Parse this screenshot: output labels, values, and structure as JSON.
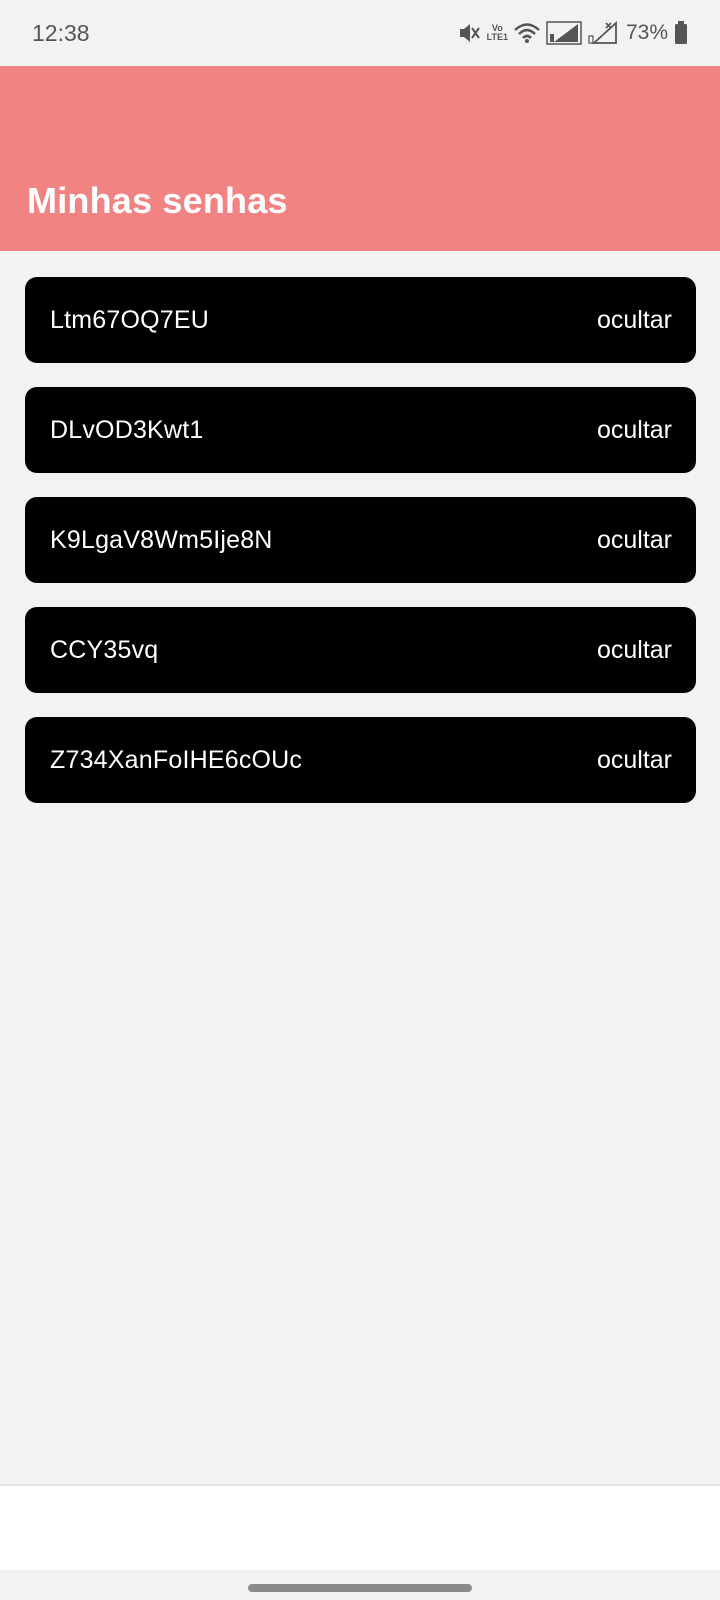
{
  "status_bar": {
    "time": "12:38",
    "battery_percent": "73%",
    "icons": [
      "mute-icon",
      "volte-icon",
      "wifi-icon",
      "signal-icon",
      "no-signal-icon",
      "battery-icon"
    ],
    "volte_label_top": "Vo",
    "volte_label_bottom": "LTE1"
  },
  "header": {
    "title": "Minhas senhas",
    "color": "#f28383"
  },
  "passwords": [
    {
      "value": "Ltm67OQ7EU",
      "toggle_label": "ocultar"
    },
    {
      "value": "DLvOD3Kwt1",
      "toggle_label": "ocultar"
    },
    {
      "value": "K9LgaV8Wm5Ije8N",
      "toggle_label": "ocultar"
    },
    {
      "value": "CCY35vq",
      "toggle_label": "ocultar"
    },
    {
      "value": "Z734XanFoIHE6cOUc",
      "toggle_label": "ocultar"
    }
  ]
}
